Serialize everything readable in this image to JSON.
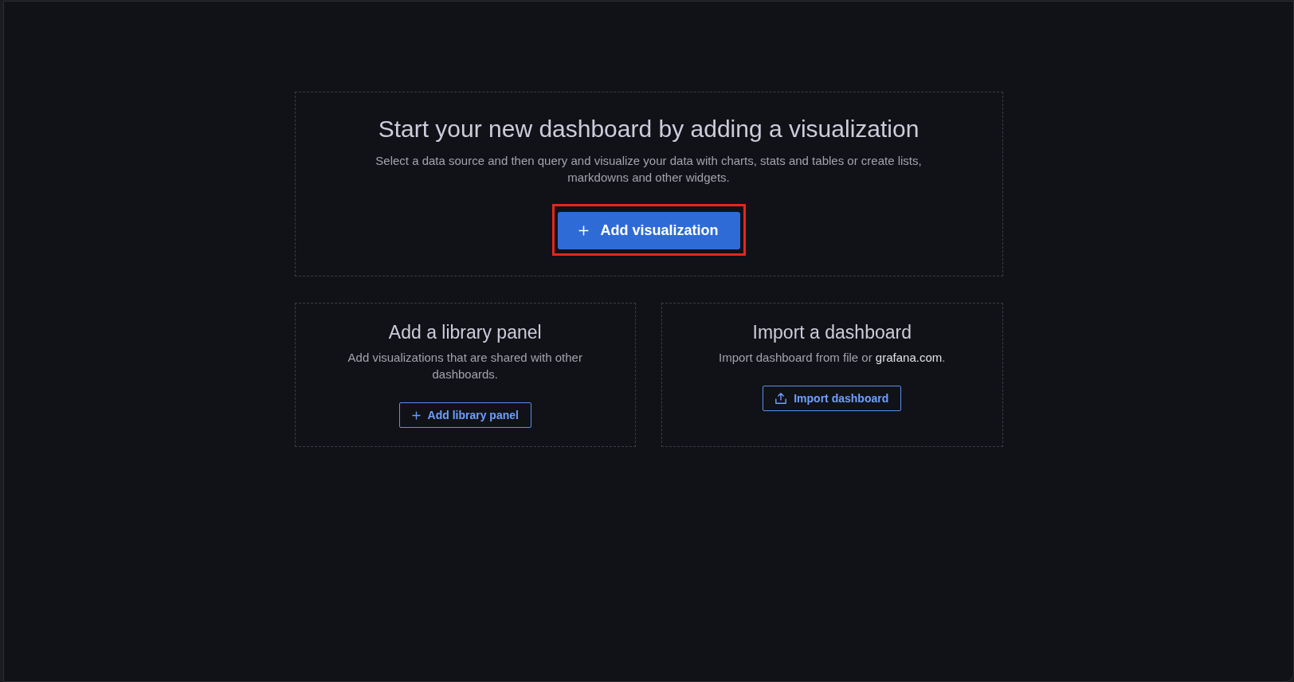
{
  "hero": {
    "title": "Start your new dashboard by adding a visualization",
    "description": "Select a data source and then query and visualize your data with charts, stats and tables or create lists, markdowns and other widgets.",
    "button": {
      "label": "Add visualization",
      "highlighted": true
    }
  },
  "cards": [
    {
      "kind": "add",
      "title": "Add a library panel",
      "description": {
        "text": "Add visualizations that are shared with other dashboards."
      },
      "button": {
        "label": "Add library panel"
      }
    },
    {
      "kind": "import",
      "title": "Import a dashboard",
      "description": {
        "text": "Import dashboard from file or",
        "link": "grafana.com",
        "after": "."
      },
      "button": {
        "label": "Import dashboard"
      }
    }
  ]
}
